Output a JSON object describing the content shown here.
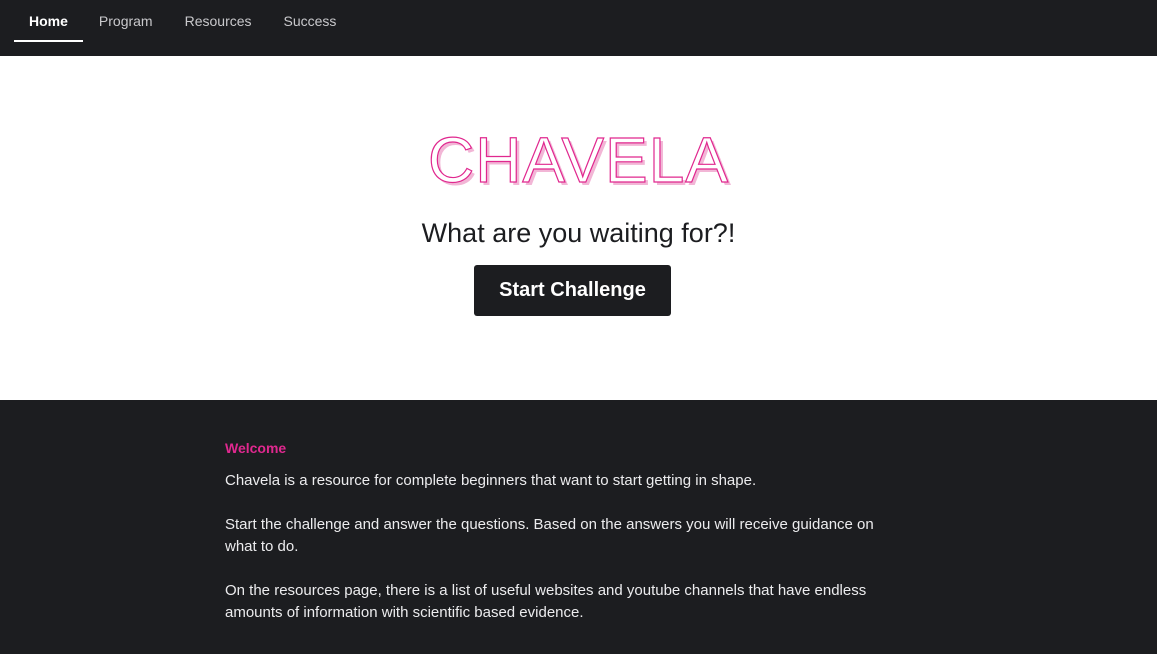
{
  "nav": {
    "items": [
      {
        "label": "Home",
        "active": true
      },
      {
        "label": "Program",
        "active": false
      },
      {
        "label": "Resources",
        "active": false
      },
      {
        "label": "Success",
        "active": false
      }
    ]
  },
  "hero": {
    "brand": "CHAVELA",
    "tagline": "What are you waiting for?!",
    "cta_label": "Start Challenge"
  },
  "about": {
    "heading": "Welcome",
    "paragraphs": [
      "Chavela is a resource for complete beginners that want to start getting in shape.",
      "Start the challenge and answer the questions. Based on the answers you will receive guidance on what to do.",
      "On the resources page, there is a list of useful websites and youtube channels that have endless amounts of information with scientific based evidence."
    ]
  },
  "colors": {
    "accent": "#e0288f",
    "dark": "#1c1d20",
    "light": "#ffffff"
  }
}
